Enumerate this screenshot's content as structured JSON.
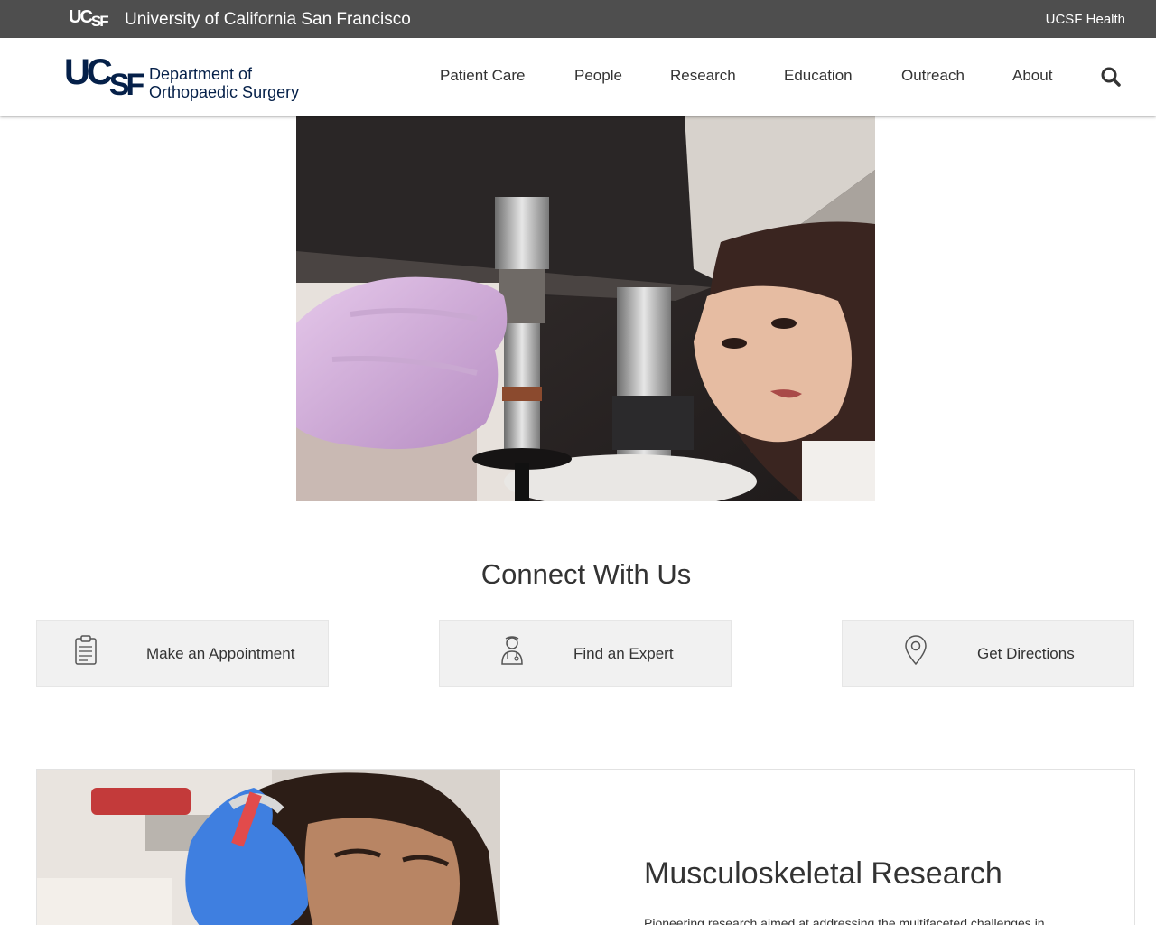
{
  "topbar": {
    "logo_text": "UCSF",
    "university_name": "University of California San Francisco",
    "health_link": "UCSF Health"
  },
  "header": {
    "brand_mark": "UCSF",
    "department_line1": "Department of",
    "department_line2": "Orthopaedic Surgery",
    "nav": [
      "Patient Care",
      "People",
      "Research",
      "Education",
      "Outreach",
      "About"
    ],
    "search_icon": "search-icon"
  },
  "hero": {
    "image_subject": "researcher-at-testing-machine"
  },
  "connect": {
    "title": "Connect With Us",
    "cards": [
      {
        "label": "Make an Appointment",
        "icon": "clipboard-icon"
      },
      {
        "label": "Find an Expert",
        "icon": "doctor-icon"
      },
      {
        "label": "Get Directions",
        "icon": "map-pin-icon"
      }
    ]
  },
  "research": {
    "title": "Musculoskeletal Research",
    "description": "Pioneering research aimed at addressing the multifaceted challenges in"
  },
  "colors": {
    "topbar_bg": "#4e4e4e",
    "brand_navy": "#052049",
    "card_bg": "#f1f1f1"
  }
}
